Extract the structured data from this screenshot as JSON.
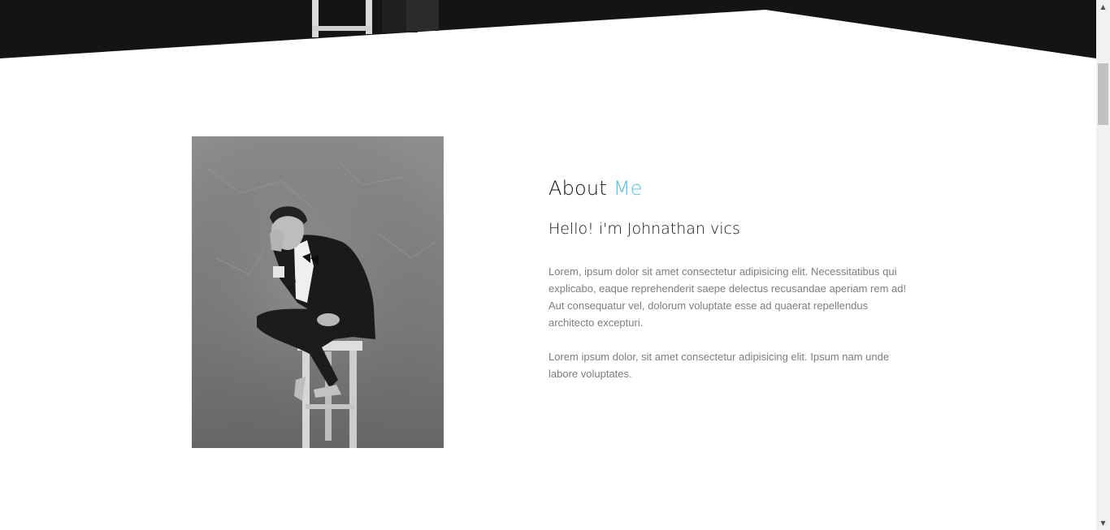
{
  "about": {
    "title_prefix": "About",
    "title_accent": "Me",
    "greeting": "Hello! i'm Johnathan vics",
    "paragraphs": [
      "Lorem, ipsum dolor sit amet consectetur adipisicing elit. Necessitatibus qui explicabo, eaque reprehenderit saepe delectus recusandae aperiam rem ad! Aut consequatur vel, dolorum voluptate esse ad quaerat repellendus architecto excepturi.",
      "Lorem ipsum dolor, sit amet consectetur adipisicing elit. Ipsum nam unde labore voluptates."
    ]
  },
  "colors": {
    "accent": "#4fc1d6",
    "hero_background": "#141414",
    "body_text": "#7d7d7d",
    "heading_text": "#111111"
  },
  "icons": {
    "scroll_up": "triangle-up",
    "scroll_down": "triangle-down"
  },
  "scrollbar": {
    "up_glyph": "▲",
    "down_glyph": "▼"
  }
}
